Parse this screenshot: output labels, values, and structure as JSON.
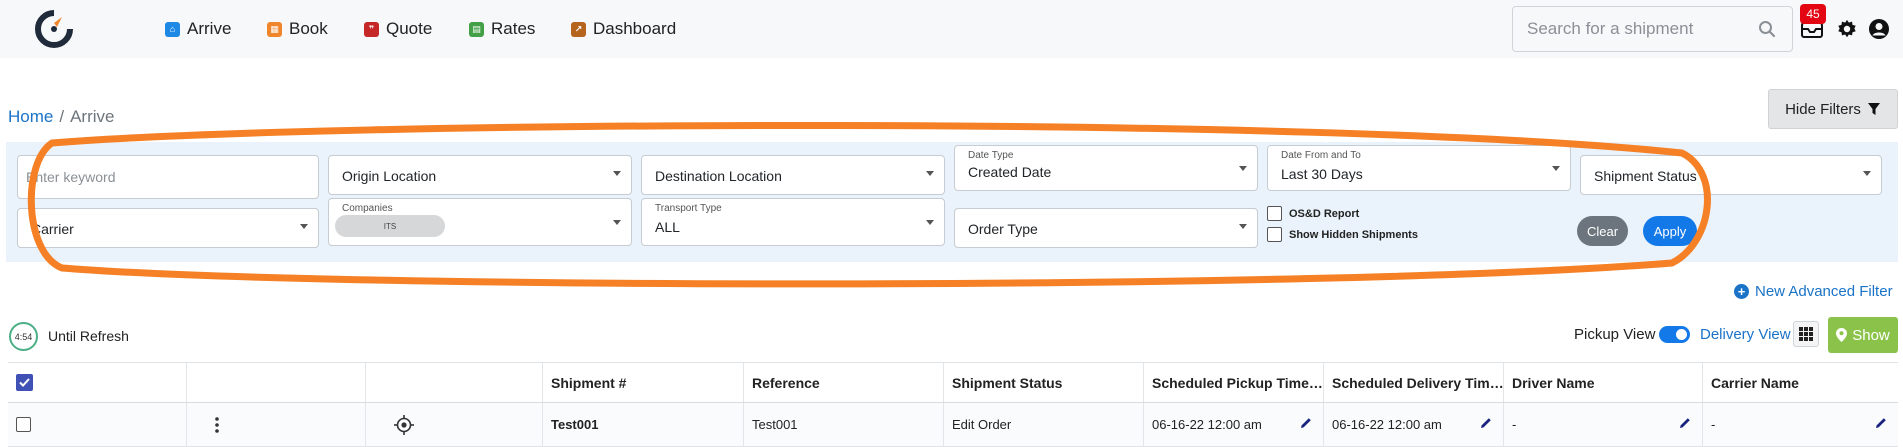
{
  "nav": {
    "items": [
      {
        "label": "Arrive",
        "icon": "home-icon",
        "color": "#1e88e5"
      },
      {
        "label": "Book",
        "icon": "calendar-icon",
        "color": "#f0862b"
      },
      {
        "label": "Quote",
        "icon": "quote-icon",
        "color": "#c62828"
      },
      {
        "label": "Rates",
        "icon": "rates-icon",
        "color": "#43a047"
      },
      {
        "label": "Dashboard",
        "icon": "chart-icon",
        "color": "#b5651d"
      }
    ],
    "search_placeholder": "Search for a shipment",
    "notification_count": "45"
  },
  "breadcrumb": {
    "home": "Home",
    "separator": "/",
    "current": "Arrive"
  },
  "hide_filters_label": "Hide Filters",
  "filters": {
    "keyword_placeholder": "Enter keyword",
    "origin_location": "Origin Location",
    "destination_location": "Destination Location",
    "date_type_label": "Date Type",
    "date_type_value": "Created Date",
    "date_range_label": "Date From and To",
    "date_range_value": "Last 30 Days",
    "shipment_status": "Shipment Status",
    "carrier": "Carrier",
    "companies_label": "Companies",
    "companies_chip": "ITS",
    "transport_type_label": "Transport Type",
    "transport_type_value": "ALL",
    "order_type": "Order Type",
    "osd_report_label": "OS&D Report",
    "show_hidden_label": "Show Hidden Shipments",
    "clear_label": "Clear",
    "apply_label": "Apply"
  },
  "advanced_filter_label": "New Advanced Filter",
  "refresh": {
    "timer": "4:54",
    "label": "Until Refresh"
  },
  "view": {
    "pickup_label": "Pickup View",
    "delivery_label": "Delivery View",
    "show_label": "Show"
  },
  "table": {
    "headers": [
      "",
      "",
      "",
      "Shipment #",
      "Reference",
      "Shipment Status",
      "Scheduled Pickup Time…",
      "Scheduled Delivery Tim…",
      "Driver Name",
      "Carrier Name"
    ],
    "rows": [
      {
        "shipment": "Test001",
        "reference": "Test001",
        "status": "Edit Order",
        "pickup": "06-16-22 12:00 am",
        "delivery": "06-16-22 12:00 am",
        "driver": "-",
        "carrier": "-"
      }
    ]
  },
  "colors": {
    "accent": "#1479e8",
    "highlight": "#f58025",
    "filter_bg": "#eaf3fb",
    "show_button": "#8bc34a"
  }
}
